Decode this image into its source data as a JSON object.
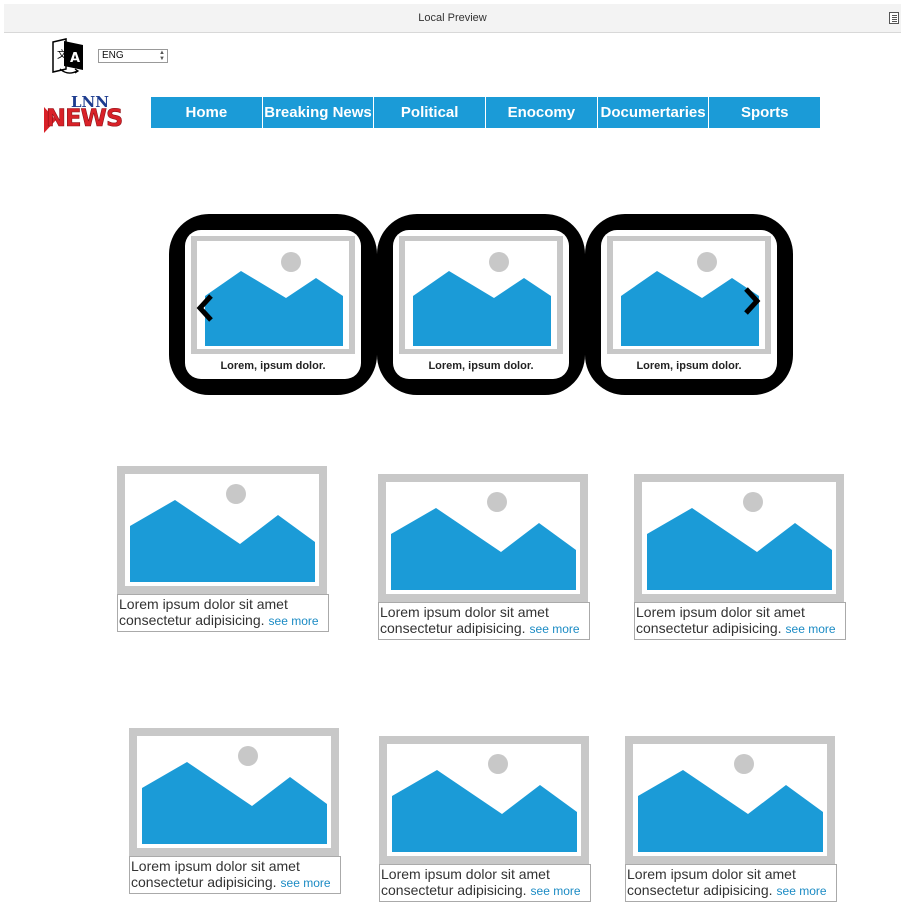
{
  "window": {
    "title": "Local Preview"
  },
  "language": {
    "selected": "ENG"
  },
  "brand": {
    "line1": "LNN",
    "line2": "NEWS"
  },
  "nav": {
    "items": [
      {
        "label": "Home"
      },
      {
        "label": "Breaking News"
      },
      {
        "label": "Political"
      },
      {
        "label": "Enocomy"
      },
      {
        "label": "Documertaries"
      },
      {
        "label": "Sports"
      }
    ]
  },
  "carousel": {
    "slides": [
      {
        "caption": "Lorem, ipsum dolor."
      },
      {
        "caption": "Lorem, ipsum dolor."
      },
      {
        "caption": "Lorem, ipsum dolor."
      }
    ]
  },
  "articles": [
    {
      "line1": "Lorem ipsum dolor sit amet",
      "line2": "consectetur adipisicing.",
      "more": "see more"
    },
    {
      "line1": "Lorem ipsum dolor sit amet",
      "line2": "consectetur adipisicing.",
      "more": "see more"
    },
    {
      "line1": "Lorem ipsum dolor sit amet",
      "line2": "consectetur adipisicing.",
      "more": "see more"
    },
    {
      "line1": "Lorem ipsum dolor sit amet",
      "line2": "consectetur adipisicing.",
      "more": "see more"
    },
    {
      "line1": "Lorem ipsum dolor sit amet",
      "line2": "consectetur adipisicing.",
      "more": "see more"
    },
    {
      "line1": "Lorem ipsum dolor sit amet",
      "line2": "consectetur adipisicing.",
      "more": "see more"
    }
  ],
  "colors": {
    "accent": "#1b9bd7",
    "brand_red": "#d92128",
    "brand_blue": "#1d3c8f",
    "placeholder_frame": "#c8c8c8"
  },
  "icons": {
    "translate": "translate-icon",
    "menu": "document-icon",
    "carousel_prev": "chevron-left-icon",
    "carousel_next": "chevron-right-icon"
  }
}
